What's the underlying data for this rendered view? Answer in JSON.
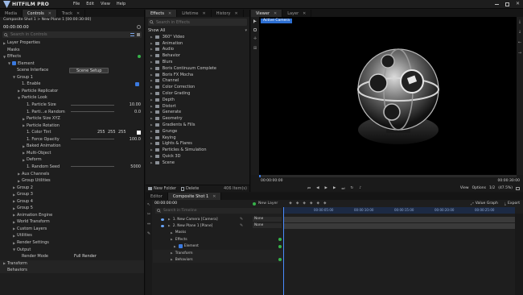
{
  "app": {
    "name": "HITFILM PRO",
    "menu": [
      "File",
      "Edit",
      "View",
      "Help"
    ]
  },
  "left_panel": {
    "tabs": [
      "Media",
      "Controls",
      "Track"
    ],
    "active_tab": "Controls",
    "header": "Composite Shot 1 > New Plane 1 [00:00:30:00]",
    "timecode": "00:00:00:00",
    "search_placeholder": "Search in Controls",
    "rows": [
      {
        "label": "Layer Properties",
        "indent": 0,
        "arrow": "▶"
      },
      {
        "label": "Masks",
        "indent": 0,
        "arrow": ""
      },
      {
        "label": "Effects",
        "indent": 0,
        "arrow": "▼",
        "dot": true
      },
      {
        "label": "Element",
        "indent": 1,
        "arrow": "▼",
        "check": true
      },
      {
        "label": "Scene Interface",
        "indent": 2,
        "arrow": "",
        "button": "Scene Setup"
      },
      {
        "label": "Group 1",
        "indent": 2,
        "arrow": "▼"
      },
      {
        "label": "1. Enable",
        "indent": 3,
        "arrow": "",
        "check": true
      },
      {
        "label": "Particle Replicator",
        "indent": 3,
        "arrow": "▶"
      },
      {
        "label": "Particle Look",
        "indent": 3,
        "arrow": "▼"
      },
      {
        "label": "1. Particle Size",
        "indent": 4,
        "arrow": "",
        "value": "10.00",
        "slider": true
      },
      {
        "label": "1. Parti...e Random",
        "indent": 4,
        "arrow": "",
        "value": "0.0",
        "slider": true
      },
      {
        "label": "Particle Size XYZ",
        "indent": 4,
        "arrow": "▶"
      },
      {
        "label": "Particle Rotation",
        "indent": 4,
        "arrow": "▶"
      },
      {
        "label": "1. Color Tint",
        "indent": 4,
        "arrow": "",
        "rgb": [
          "255",
          "255",
          "255"
        ]
      },
      {
        "label": "1. Force Opacity",
        "indent": 4,
        "arrow": "",
        "value": "100.0",
        "slider": true
      },
      {
        "label": "Baked Animation",
        "indent": 4,
        "arrow": "▶"
      },
      {
        "label": "Multi-Object",
        "indent": 4,
        "arrow": "▶"
      },
      {
        "label": "Deform",
        "indent": 4,
        "arrow": "▶"
      },
      {
        "label": "1. Random Seed",
        "indent": 4,
        "arrow": "",
        "value": "5000",
        "slider": true
      },
      {
        "label": "Aux Channels",
        "indent": 3,
        "arrow": "▶"
      },
      {
        "label": "Group Utilities",
        "indent": 3,
        "arrow": "▶"
      },
      {
        "label": "Group 2",
        "indent": 2,
        "arrow": "▶"
      },
      {
        "label": "Group 3",
        "indent": 2,
        "arrow": "▶"
      },
      {
        "label": "Group 4",
        "indent": 2,
        "arrow": "▶"
      },
      {
        "label": "Group 5",
        "indent": 2,
        "arrow": "▶"
      },
      {
        "label": "Animation Engine",
        "indent": 2,
        "arrow": "▶"
      },
      {
        "label": "World Transform",
        "indent": 2,
        "arrow": "▶"
      },
      {
        "label": "Custom Layers",
        "indent": 2,
        "arrow": "▶"
      },
      {
        "label": "Utilities",
        "indent": 2,
        "arrow": "▶"
      },
      {
        "label": "Render Settings",
        "indent": 2,
        "arrow": "▶"
      },
      {
        "label": "Output",
        "indent": 2,
        "arrow": "▼"
      },
      {
        "label": "Render Mode",
        "indent": 3,
        "arrow": "",
        "select": "Full Render"
      },
      {
        "label": "Transform",
        "indent": 0,
        "arrow": "▶"
      },
      {
        "label": "Behaviors",
        "indent": 0,
        "arrow": ""
      }
    ]
  },
  "effects_panel": {
    "tabs": [
      "Effects",
      "Lifetime",
      "History"
    ],
    "search_placeholder": "Search in Effects",
    "filter": "Show All",
    "items": [
      "360° Video",
      "Animation",
      "Audio",
      "Behavior",
      "Blurs",
      "Boris Continuum Complete",
      "Boris FX Mocha",
      "Channel",
      "Color Correction",
      "Color Grading",
      "Depth",
      "Distort",
      "Generate",
      "Geometry",
      "Gradients & Fills",
      "Grunge",
      "Keying",
      "Lights & Flares",
      "Particles & Simulation",
      "Quick 3D",
      "Scene"
    ],
    "new_folder": "New Folder",
    "delete": "Delete",
    "count": "406 Item(s)"
  },
  "viewer": {
    "tabs": [
      "Viewer",
      "Layer"
    ],
    "badge": "Active Camera",
    "timecode_left": "00:00:00:00",
    "timecode_right": "00:00:30:00",
    "view_label": "View",
    "options_label": "Options",
    "quality": "1/2",
    "zoom": "(47.5%)"
  },
  "timeline": {
    "tabs": [
      "Editor",
      "Composite Shot 1"
    ],
    "timecode": "00:00:00:00",
    "new_layer": "New Layer",
    "value_graph": "Value Graph",
    "export": "Export",
    "search_placeholder": "Search in Timeline",
    "ruler": [
      "00:00:05:00",
      "00:00:10:00",
      "00:00:15:00",
      "00:00:20:00",
      "00:00:25:00"
    ],
    "layers": [
      {
        "label": "1. New Camera [Camera]",
        "blend": "None",
        "indent": 1
      },
      {
        "label": "2. New Plane 1 [Plane]",
        "blend": "None",
        "indent": 1
      },
      {
        "label": "Masks",
        "indent": 2
      },
      {
        "label": "Effects",
        "indent": 2
      },
      {
        "label": "Element",
        "indent": 3
      },
      {
        "label": "Transform",
        "indent": 2
      },
      {
        "label": "Behaviors",
        "indent": 2
      }
    ]
  }
}
